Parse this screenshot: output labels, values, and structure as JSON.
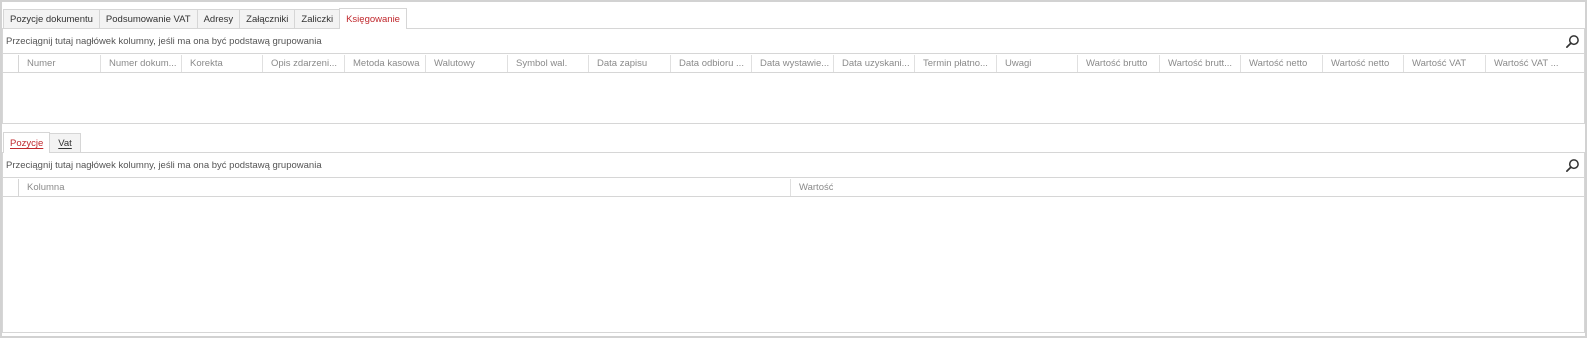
{
  "top_tabs": [
    {
      "label": "Pozycje dokumentu"
    },
    {
      "label": "Podsumowanie VAT"
    },
    {
      "label": "Adresy"
    },
    {
      "label": "Załączniki"
    },
    {
      "label": "Zaliczki"
    },
    {
      "label": "Księgowanie",
      "active": true
    }
  ],
  "top_grid": {
    "group_hint": "Przeciągnij tutaj nagłówek kolumny, jeśli ma ona być podstawą grupowania",
    "columns": [
      "Numer",
      "Numer dokum...",
      "Korekta",
      "Opis zdarzeni...",
      "Metoda kasowa",
      "Walutowy",
      "Symbol wal.",
      "Data zapisu",
      "Data odbioru ...",
      "Data wystawie...",
      "Data uzyskani...",
      "Termin płatno...",
      "Uwagi",
      "Wartość brutto",
      "Wartość brutt...",
      "Wartość netto",
      "Wartość netto",
      "Wartość VAT",
      "Wartość VAT ..."
    ]
  },
  "bottom_tabs": [
    {
      "label": "Pozycje",
      "active": true
    },
    {
      "label": "Vat"
    }
  ],
  "bottom_grid": {
    "group_hint": "Przeciągnij tutaj nagłówek kolumny, jeśli ma ona być podstawą grupowania",
    "columns": [
      "Kolumna",
      "Wartość"
    ]
  },
  "colors": {
    "active_tab_text": "#c0282d",
    "border": "#d6d6d6",
    "header_text": "#8a8a8a"
  }
}
